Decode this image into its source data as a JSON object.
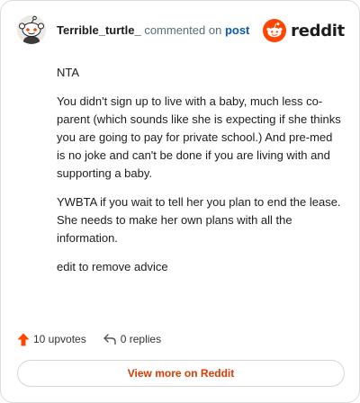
{
  "header": {
    "username": "Terrible_turtle_",
    "commented_text": "commented on",
    "post_link": "post",
    "logo_text": "reddit",
    "avatar_icon": "snoo-avatar-icon",
    "logo_icon": "reddit-snoo-icon"
  },
  "comment": {
    "paragraphs": [
      "NTA",
      "You didn't sign up to live with a baby, much less co-parent (which sounds like she is expecting if she thinks you are going to pay for private school.) And pre-med is no joke and can't be done if you are living with and supporting a baby.",
      "YWBTA if you wait to tell her you plan to end the lease. She needs to make her own plans with all the information.",
      "edit to remove advice"
    ]
  },
  "footer": {
    "upvotes": "10 upvotes",
    "replies": "0 replies",
    "upvote_icon": "upvote-arrow-icon",
    "reply_icon": "reply-arrow-icon"
  },
  "view_more": {
    "label": "View more on Reddit"
  },
  "colors": {
    "brand": "#ff4500",
    "link": "#0a5aad",
    "view_more": "#d93a00"
  }
}
